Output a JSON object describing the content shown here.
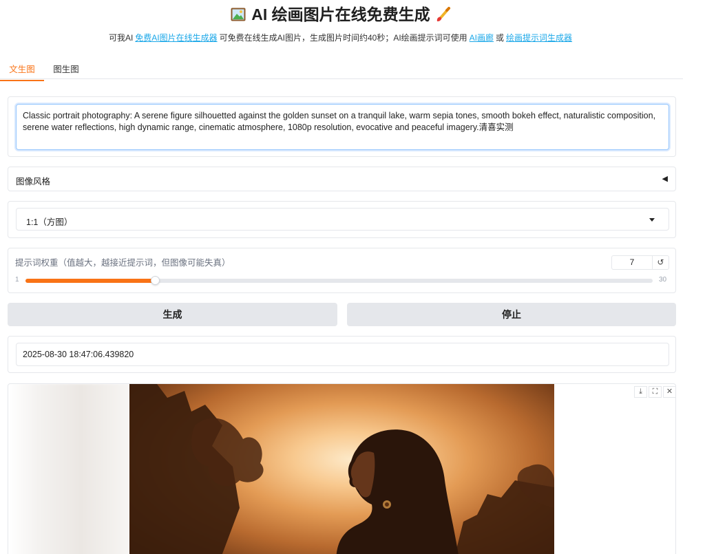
{
  "header": {
    "title": "AI 绘画图片在线免费生成",
    "subtitle_prefix": "可我AI",
    "link1": "免费AI图片在线生成器",
    "subtitle_mid": "可免费在线生成AI图片，生成图片时间约40秒；AI绘画提示词可使用",
    "link2": "AI画廊",
    "subtitle_or": "或",
    "link3": "绘画提示词生成器"
  },
  "tabs": [
    {
      "label": "文生图",
      "active": true
    },
    {
      "label": "图生图",
      "active": false
    }
  ],
  "prompt": {
    "value": "Classic portrait photography: A serene figure silhouetted against the golden sunset on a tranquil lake, warm sepia tones, smooth bokeh effect, naturalistic composition, serene water reflections, high dynamic range, cinematic atmosphere, 1080p resolution, evocative and peaceful imagery.清喜实测"
  },
  "style_accordion": {
    "label": "图像风格",
    "arrow": "◀"
  },
  "aspect_select": {
    "value": "1:1（方图）"
  },
  "guidance": {
    "label": "提示词权重（值越大，越接近提示词，但图像可能失真）",
    "value": "7",
    "min": "1",
    "max": "30",
    "reset_symbol": "↺"
  },
  "actions": {
    "generate": "生成",
    "stop": "停止"
  },
  "timestamp": {
    "value": "2025-08-30 18:47:06.439820"
  },
  "image_toolbar": {
    "download": "⤓",
    "fullscreen": "⛶",
    "close": "✕"
  },
  "colors": {
    "accent": "#f97316",
    "link": "#1aa7e8",
    "button_bg": "#e5e7eb"
  }
}
